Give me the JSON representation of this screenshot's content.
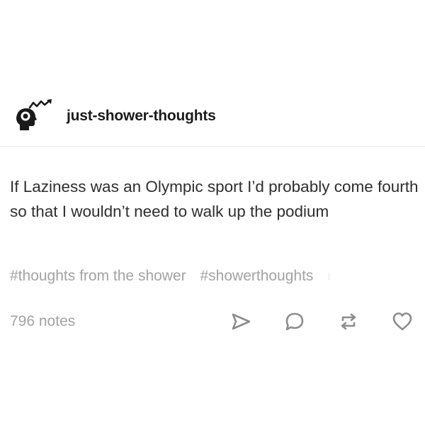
{
  "post": {
    "blog_name": "just-shower-thoughts",
    "body": "If Laziness was an Olympic sport I’d probably come fourth so that I wouldn’t need to walk up the podium",
    "tags": [
      "#thoughts from the shower",
      "#showerthoughts"
    ],
    "notes_label": "796 notes"
  },
  "icons": {
    "avatar": "head-brain-avatar-icon",
    "share": "share-icon",
    "reply": "reply-bubble-icon",
    "reblog": "reblog-icon",
    "like": "heart-icon"
  },
  "colors": {
    "text_primary": "#2e2e2e",
    "text_secondary": "#a3a3a3",
    "icon_color": "#8c8c8c",
    "background": "#ffffff"
  }
}
